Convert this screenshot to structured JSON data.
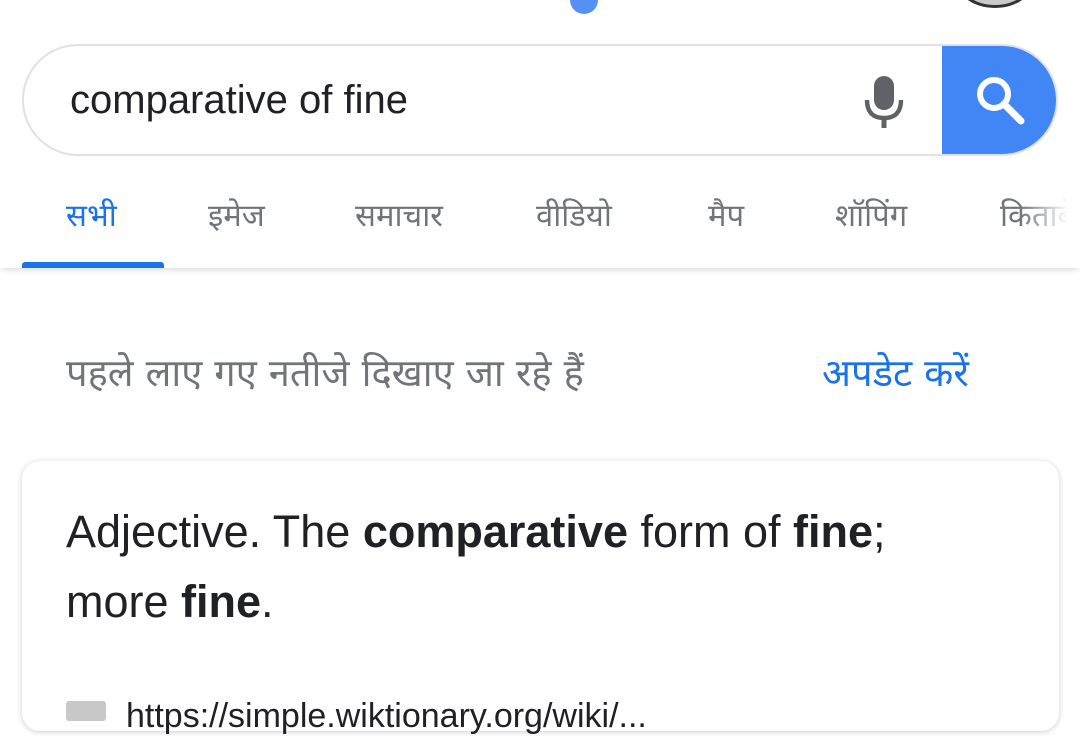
{
  "search": {
    "query": "comparative of fine"
  },
  "tabs": [
    {
      "label": "सभी",
      "active": true
    },
    {
      "label": "इमेज",
      "active": false
    },
    {
      "label": "समाचार",
      "active": false
    },
    {
      "label": "वीडियो",
      "active": false
    },
    {
      "label": "मैप",
      "active": false
    },
    {
      "label": "शॉपिंग",
      "active": false
    },
    {
      "label": "किताबें",
      "active": false
    }
  ],
  "notice": {
    "text": "पहले लाए गए नतीजे दिखाए जा रहे हैं",
    "action": "अपडेट करें"
  },
  "answer": {
    "p1": "Adjective. The ",
    "b1": "comparative",
    "p2": " form of ",
    "b2": "fine",
    "p3": ";",
    "p4": "more ",
    "b3": "fine",
    "p5": "."
  },
  "source": {
    "url": "https://simple.wiktionary.org/wiki/..."
  },
  "colors": {
    "accent": "#1a73e8",
    "search_button": "#4285f4",
    "muted_text": "#70757a"
  },
  "icons": [
    "mic-icon",
    "search-icon",
    "favicon-icon"
  ]
}
